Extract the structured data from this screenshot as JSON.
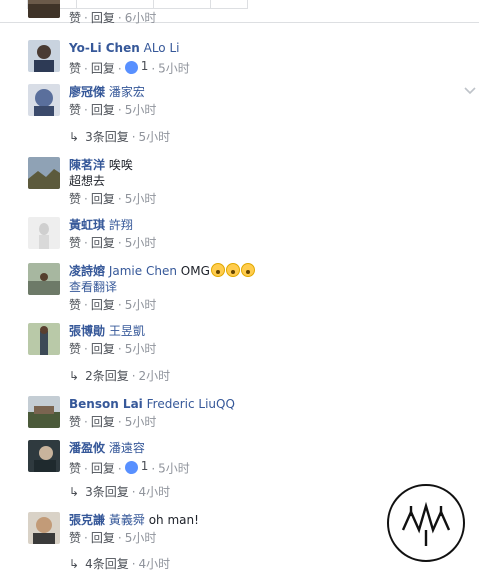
{
  "comments": [
    {
      "author": "",
      "tag": "",
      "text": "",
      "like": "赞",
      "reply": "回复",
      "likes": "",
      "time": "6小时"
    },
    {
      "author": "Yo-Li Chen",
      "tag": "ALo Li",
      "text": "",
      "like": "赞",
      "reply": "回复",
      "likes": "1",
      "time": "5小时"
    },
    {
      "author": "廖冠傑",
      "tag": "潘家宏",
      "text": "",
      "like": "赞",
      "reply": "回复",
      "likes": "",
      "time": "5小时"
    },
    {
      "author": "陳茗洋",
      "tag": "唉唉",
      "text": "超想去",
      "like": "赞",
      "reply": "回复",
      "likes": "",
      "time": "5小时"
    },
    {
      "author": "黃虹琪",
      "tag": "許翔",
      "text": "",
      "like": "赞",
      "reply": "回复",
      "likes": "",
      "time": "5小时"
    },
    {
      "author": "凌詩嫆",
      "tag": "Jamie Chen",
      "text": "OMG",
      "text2": "查看翻译",
      "like": "赞",
      "reply": "回复",
      "likes": "",
      "time": "5小时"
    },
    {
      "author": "張博勛",
      "tag": "王昱凱",
      "text": "",
      "like": "赞",
      "reply": "回复",
      "likes": "",
      "time": "5小时"
    },
    {
      "author": "Benson Lai",
      "tag": "Frederic LiuQQ",
      "text": "",
      "like": "赞",
      "reply": "回复",
      "likes": "",
      "time": "5小时"
    },
    {
      "author": "潘盈攸",
      "tag": "潘遠容",
      "text": "",
      "like": "赞",
      "reply": "回复",
      "likes": "1",
      "time": "5小时"
    },
    {
      "author": "張克謙",
      "tag": "黃義舜",
      "text": "oh man!",
      "like": "赞",
      "reply": "回复",
      "likes": "",
      "time": "5小时"
    }
  ],
  "replies": [
    {
      "label": "3条回复",
      "time": "5小时"
    },
    {
      "label": "2条回复",
      "time": "2小时"
    },
    {
      "label": "3条回复",
      "time": "4小时"
    },
    {
      "label": "4条回复",
      "time": "4小时"
    }
  ],
  "colors": {
    "link": "#365899",
    "meta": "#90949c",
    "like_badge": "#5890ff"
  }
}
